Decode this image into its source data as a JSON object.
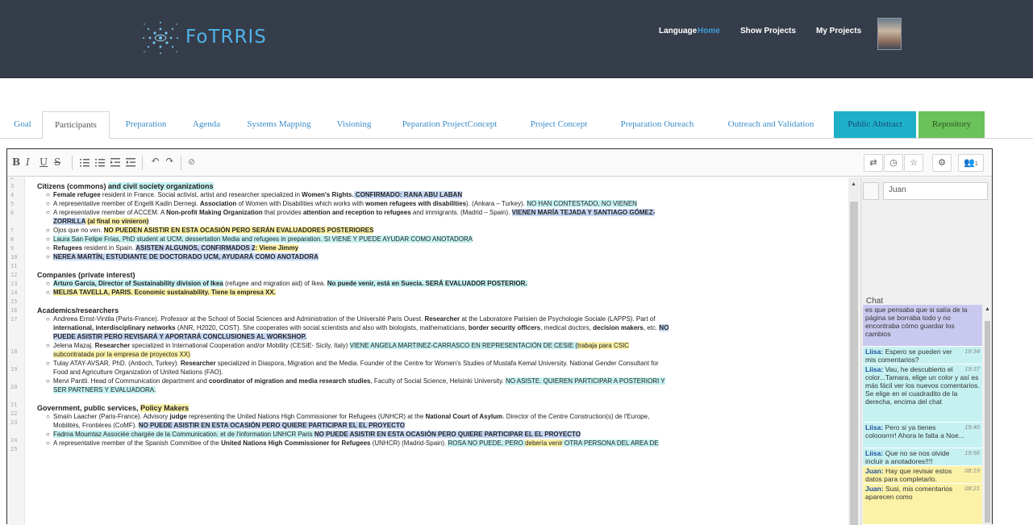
{
  "app": {
    "brand": "FoTRRIS"
  },
  "nav": {
    "items": [
      "Language",
      "Home",
      "Show Projects",
      "My Projects"
    ],
    "active": "Home"
  },
  "tabs": [
    "Goal",
    "Participants",
    "Preparation",
    "Agenda",
    "Systems Mapping",
    "Visioning",
    "Peparation ProjectConcept",
    "Project Concept",
    "Preparation Oureach",
    "Outreach and Validation",
    "Public Abstract",
    "Repository"
  ],
  "active_tab": "Participants",
  "toolbar": {
    "bold": "B",
    "italic": "I",
    "underline": "U",
    "strike": "S",
    "users_count": "1"
  },
  "gutter": [
    "2",
    "3",
    "4",
    "5",
    "6",
    "",
    "7",
    "8",
    "9",
    "10",
    "11",
    "12",
    "13",
    "14",
    "15",
    "16",
    "17",
    "",
    "",
    "18",
    "",
    "19",
    "",
    "20",
    "",
    "21",
    "22",
    "23",
    "",
    "24",
    "25"
  ],
  "doc": {
    "h_citizens_a": "Citizens (commons) ",
    "h_citizens_b": "and civil society organizations",
    "c1_a": "Female refugee",
    "c1_b": " resident in France. Social activist, artist and researcher specialized in ",
    "c1_c": "Women's Rights.",
    "c1_d": " CONFIRMADO:  RANA ABU LABAN",
    "c2_a": "A representative member of Engelli Kadin Dernegi. ",
    "c2_b": "Association",
    "c2_c": " of Women with Disabilities which works with ",
    "c2_d": "women refugees with disabilities",
    "c2_e": "). (Ankara – Turkey). ",
    "c2_f": "NO HAN CONTESTADO, NO VIENEN",
    "c3_a": "A representative member of ACCEM. A ",
    "c3_b": "Non-profit Making Organization",
    "c3_c": " that provides ",
    "c3_d": "attention and reception to refugees",
    "c3_e": " and immigrants. (Madrid – Spain). ",
    "c3_f": " VIENEN MARÍA TEJADA Y SANTIAGO GÓMEZ-",
    "c3_g": "ZORRILLA",
    "c3_h": " (al final no vinieron)",
    "c4_a": "Ojos que no ven. ",
    "c4_b": " NO PUEDEN ASISTIR EN ESTA OCASIÓN PERO SERÁN EVALUADORES POSTERIORES",
    "c5_a": "Laura San Felipe Frías, PhD student at UCM, dessertation Media and refugees in preparation. SI VIENE Y PUEDE AYUDAR COMO ANOTADORA",
    "c6_a": "Refugees",
    "c6_b": " resident in Spain. ",
    "c6_c": "ASISTEN ALGUNOS, CONFIRMADOS 2",
    "c6_d": ": Viene Jimmy",
    "c7_a": "NEREA MARTÍN, ESTUDIANTE DE DOCTORADO UCM, AYUDARÁ COMO ANOTADORA",
    "h_companies": "Companies (private interest)",
    "p1_a": "Arturo García, Director of Sustainability division of Ikea",
    "p1_b": " (refugee and migration aid) of Ikea. ",
    "p1_c": "No puede venir, está en Suecia. SERÁ EVALUADOR POSTERIOR.",
    "p2_a": "MELISA TAVELLA, PARIS. Economic sustainability. Tiene la empresa XX.",
    "h_academics": "Academics/researchers",
    "a1_a": "Andreea Ernst-Vintila (Paris-France). Professor at the School of Social Sciences and Administration of the Université Paris Ouest. ",
    "a1_b": "Researcher",
    "a1_c": " at the Laboratoire Parisien de Psychologie Sociale (LAPPS). Part of",
    "a1_d": "international, interdisciplinary networks",
    "a1_e": " (ANR, H2020, COST). She cooperates with social scientists and also with biologists, mathematicians, ",
    "a1_f": "border security officers",
    "a1_g": ", medical doctors, ",
    "a1_h": "decision makers",
    "a1_i": ", etc. ",
    "a1_j": "NO",
    "a1_k": "PUEDE ASISTIR PERO REVISARÁ Y APORTARÁ CONCLUSIONES AL WORKSHOP.",
    "a2_a": "Jelena Mazaj. ",
    "a2_b": "Researcher",
    "a2_c": " specialized in International Cooperation and/or Mobility (CESIE- Sicily, Italy) ",
    "a2_d": "VIENE ANGELA MARTINEZ-CARRASCO EN REPRESENTACIÓN DE CESIE (",
    "a2_e": "trabaja para CSIC",
    "a2_f": "subcontratada por la empresa de proyectos XX)",
    "a3_a": "Tulay ATAY-AVSAR, PhD. (Antioch, Turkey). ",
    "a3_b": "Researcher",
    "a3_c": " specialized in Diaspora, Migration and the Media. Founder of the Centre for Women's Studies of Mustafa Kemal University. National Gender Consultant for",
    "a3_d": "Food and Agriculture Organization of United Nations (FAO).",
    "a4_a": "Mervi Pantti. Head of Communication department and ",
    "a4_b": "coordinator of migration and media research studies",
    "a4_c": ", Faculty of Social Science, Helsinki University. ",
    "a4_d": "NO ASISTE. QUIEREN PARTICIPAR A POSTERIORI Y",
    "a4_e": "SER PARTNERS Y EVALUADORA.",
    "h_gov_a": "Government, public services, ",
    "h_gov_b": "Policy Makers",
    "g1_a": "Smaïn Laacher (Paris-France). Advisory ",
    "g1_b": "judge",
    "g1_c": " representing the United Nations High Commissioner for Refugees (UNHCR) at the ",
    "g1_d": "National Court of Asylum",
    "g1_e": ". Director of the Centre Construction(s) de l'Europe,",
    "g1_f": "Mobilités, Frontières (CoMF). ",
    "g1_g": "NO PUEDE ASISTIR EN ESTA OCASIÓN PERO QUIERE PARTICIPAR EL EL PROYECTO",
    "g2_a": "Fadma Moumtaz Associée chargée de la Communication. et de l'information UNHCR Paris ",
    "g2_b": "NO PUEDE ASISTIR EN ESTA OCASIÓN PERO QUIERE PARTICIPAR EL EL PROYECTO",
    "g3_a": "A representative member of the Spanish Committee of the ",
    "g3_b": "United Nations High Commissioner for Refugees",
    "g3_c": " (UNHCR) (Madrid-Spain). ",
    "g3_d": "ROSA NO PUEDE, PERO ",
    "g3_e": "debería venir",
    "g3_f": " OTRA PERSONA DEL AREA DE"
  },
  "sidebar": {
    "user_name": "Juan",
    "chat_title": "Chat"
  },
  "chat": [
    {
      "author": "",
      "time": "",
      "text": "es que pensaba que si salía de la página se borraba todo y no encontraba cómo guardar los cambios"
    },
    {
      "author": "Liisa:",
      "time": "19:34",
      "text": "Espero se pueden ver mis comentarios?"
    },
    {
      "author": "Liisa:",
      "time": "19:37",
      "text": "Vau, he descubierto el color...Tamara, elige un color y así es más fácil ver los nuevos comentarios. Se elige en el cuadradito de la derecha, encima del chat"
    },
    {
      "author": "Liisa:",
      "time": "19:40",
      "text": "Pero si ya tienes colooorrrr! Ahora le falta a Noe..."
    },
    {
      "author": "Liisa:",
      "time": "19:56",
      "text": "Que no se nos olvide incluir a anotadores!!!!"
    },
    {
      "author": "Juan:",
      "time": "08:19",
      "text": "Hay que revisar estos datos para completarlo."
    },
    {
      "author": "Juan:",
      "time": "08:21",
      "text": "Susi, mis comentarios aparecen como"
    }
  ]
}
